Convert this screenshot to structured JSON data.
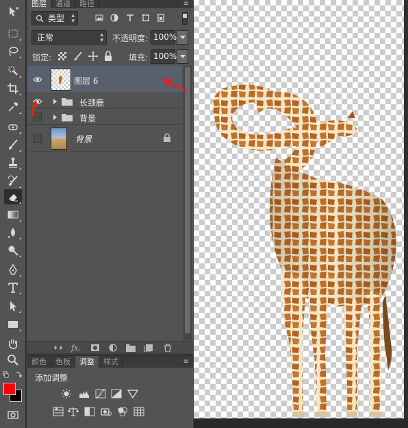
{
  "layers_panel": {
    "tabs": [
      "图层",
      "通道",
      "路径"
    ],
    "active_tab": 0,
    "filter_kind": "类型",
    "blend_mode": "正常",
    "opacity_label": "不透明度:",
    "opacity_value": "100%",
    "lock_label": "锁定:",
    "fill_label": "填充:",
    "fill_value": "100%",
    "layers": [
      {
        "name": "图层 6",
        "visible": true,
        "selected": true,
        "type": "layer"
      },
      {
        "name": "长颈鹿",
        "visible": true,
        "selected": false,
        "type": "group"
      },
      {
        "name": "背景",
        "visible": false,
        "selected": false,
        "type": "group"
      },
      {
        "name": "背景",
        "visible": false,
        "selected": false,
        "type": "background",
        "locked": true
      }
    ]
  },
  "adjust_panel": {
    "tabs": [
      "颜色",
      "色板",
      "调整",
      "样式"
    ],
    "active_tab": 2,
    "title": "添加调整"
  },
  "colors": {
    "foreground": "#ff0000",
    "background": "#000000",
    "selection": "#58606e",
    "annotation_arrow": "#e0241c"
  },
  "icons": {
    "tools": [
      "move-icon",
      "marquee-icon",
      "lasso-icon",
      "quick-select-icon",
      "crop-icon",
      "eyedropper-icon",
      "healing-icon",
      "brush-icon",
      "stamp-icon",
      "history-brush-icon",
      "eraser-icon",
      "gradient-icon",
      "blur-icon",
      "dodge-icon",
      "pen-icon",
      "type-icon",
      "path-select-icon",
      "rectangle-icon",
      "hand-icon",
      "zoom-icon"
    ],
    "canvas_content": "giraffe-cutout-image"
  }
}
